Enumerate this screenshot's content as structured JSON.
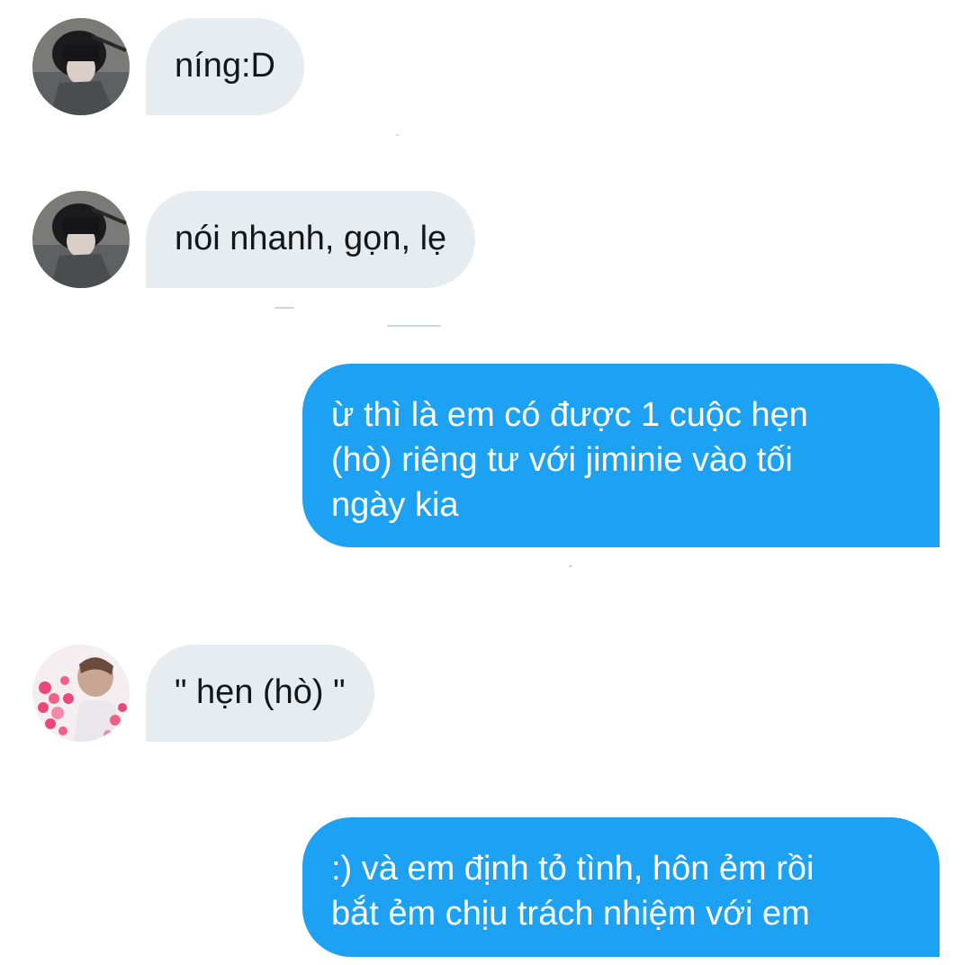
{
  "conversation": {
    "messages": [
      {
        "side": "incoming",
        "avatar": "hooded-boy-avatar",
        "text": "níng:D"
      },
      {
        "side": "incoming",
        "avatar": "hooded-boy-avatar",
        "text": "nói nhanh, gọn, lẹ"
      },
      {
        "side": "outgoing",
        "lines": [
          "ừ thì là em có được 1 cuộc hẹn",
          "(hò) riêng tư với jiminie vào tối",
          "ngày kia"
        ]
      },
      {
        "side": "incoming",
        "avatar": "hearts-boy-avatar",
        "text": "\" hẹn (hò) \""
      },
      {
        "side": "outgoing",
        "lines": [
          ":) và em định tỏ tình, hôn ẻm rồi",
          "bắt ẻm chịu trách nhiệm với em"
        ]
      }
    ]
  },
  "colors": {
    "incoming_bubble": "#e6ecf0",
    "outgoing_bubble": "#1da1f2",
    "incoming_text": "#14171a",
    "outgoing_text": "#ffffff"
  }
}
